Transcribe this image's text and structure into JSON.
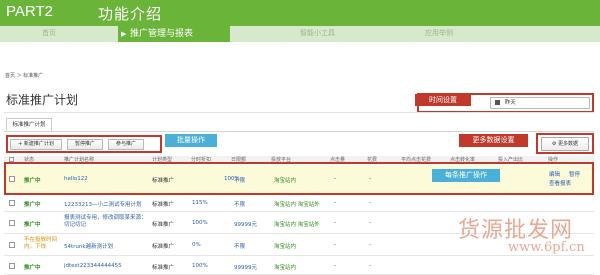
{
  "header": {
    "part": "PART2",
    "title": "功能介绍"
  },
  "nav": {
    "items": [
      "首页",
      "推广管理与报表",
      "智能小工具",
      "应用举例"
    ],
    "active_arrow": "▶"
  },
  "breadcrumb": "首页 ＞ 标准推广",
  "page_title": "标准推广计划",
  "tab": "标准推广计划",
  "toolbar": {
    "new_plan": "+ 新建推广计划",
    "pause": "暂停推广",
    "join": "参与推广",
    "more_data": "更多数据"
  },
  "date_select": {
    "icon": "calendar-icon",
    "value": "昨天"
  },
  "callouts": {
    "time_setting": "时间设置",
    "batch": "批量操作",
    "more_data_setting": "更多数据设置",
    "single_op": "每条推广操作"
  },
  "table": {
    "headers": [
      "状态",
      "推广计划名称",
      "计划类型",
      "分时折扣",
      "日限额",
      "投放平台",
      "点击量",
      "花费",
      "平均点击花费",
      "点击转化率",
      "投入产出比",
      "操作"
    ],
    "rows": [
      {
        "status": "推广中",
        "name": "hello122",
        "type": "标准推广",
        "discount": "100%",
        "limit": "不限",
        "platform": "淘宝站内",
        "ops": [
          "编辑",
          "暂停",
          "查看报表"
        ]
      },
      {
        "status": "推广中",
        "name": "12233213—小二测试专用计划",
        "type": "标准推广",
        "discount": "115%",
        "limit": "不限",
        "platform": "淘宝站内 淘宝站外",
        "ops": []
      },
      {
        "status": "推广中",
        "name": "报表测试专用，修改调取某来源：切记切记",
        "type": "标准推广",
        "discount": "100%",
        "limit": "99999元",
        "platform": "淘宝站内 淘宝站外",
        "ops": []
      },
      {
        "status": "不在投放时间内，下线",
        "name": "54trunk越新测计划",
        "type": "标准推广",
        "discount": "0%",
        "limit": "不限",
        "platform": "淘宝站内",
        "ops": []
      },
      {
        "status": "推广中",
        "name": "jdtest223344444455",
        "type": "标准推广",
        "discount": "100%",
        "limit": "99999元",
        "platform": "淘宝站内",
        "ops": []
      }
    ],
    "placeholder": "-"
  },
  "watermark": {
    "line1": "货源批发网",
    "line2": "www.6pf.cn"
  },
  "colors": {
    "brand_green": "#6bb43a",
    "annotation_red": "#c0392b",
    "annotation_blue": "#4bb0d8"
  }
}
